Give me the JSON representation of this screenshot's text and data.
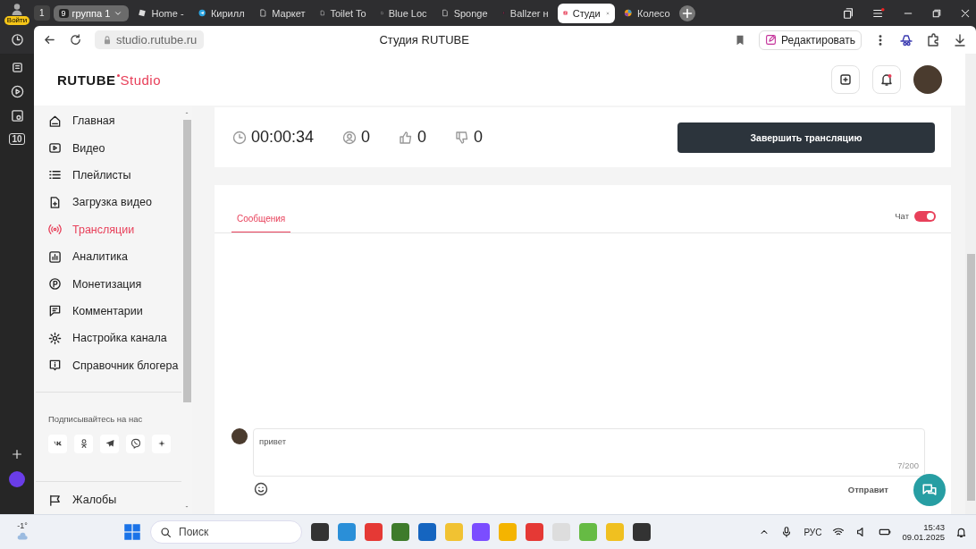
{
  "browser": {
    "account_label": "Войти",
    "tab_counter": "1",
    "group": {
      "count": "9",
      "label": "группа 1"
    },
    "tabs": [
      {
        "label": "Home -",
        "kind": "roblox",
        "selected": false
      },
      {
        "label": "Кирилл",
        "kind": "telegram",
        "selected": false
      },
      {
        "label": "Маркет",
        "kind": "doc",
        "selected": false
      },
      {
        "label": "Toilet To",
        "kind": "doc",
        "selected": false
      },
      {
        "label": "Blue Loc",
        "kind": "doc",
        "selected": false
      },
      {
        "label": "Sponge",
        "kind": "doc",
        "selected": false
      },
      {
        "label": "Ballzer н",
        "kind": "rsquare",
        "selected": false
      },
      {
        "label": "Студи",
        "kind": "studio",
        "selected": true
      },
      {
        "label": "Колесо",
        "kind": "wheel",
        "selected": false
      }
    ],
    "address": "studio.rutube.ru",
    "page_title": "Студия RUTUBE",
    "edit_label": "Редактировать",
    "rail_badge": "10"
  },
  "app": {
    "logo": {
      "brand": "RUTUBE",
      "suffix": "Studio"
    },
    "nav": [
      {
        "label": "Главная",
        "kind": "home",
        "selected": false
      },
      {
        "label": "Видео",
        "kind": "video",
        "selected": false
      },
      {
        "label": "Плейлисты",
        "kind": "list",
        "selected": false
      },
      {
        "label": "Загрузка видео",
        "kind": "upload",
        "selected": false
      },
      {
        "label": "Трансляции",
        "kind": "broadcast",
        "selected": true
      },
      {
        "label": "Аналитика",
        "kind": "chart",
        "selected": false
      },
      {
        "label": "Монетизация",
        "kind": "coin",
        "selected": false
      },
      {
        "label": "Комментарии",
        "kind": "comment",
        "selected": false
      },
      {
        "label": "Настройка канала",
        "kind": "gear",
        "selected": false
      },
      {
        "label": "Справочник блогера",
        "kind": "info",
        "selected": false
      }
    ],
    "follow_label": "Подписывайтесь на нас",
    "socials": [
      {
        "kind": "vk"
      },
      {
        "kind": "ok"
      },
      {
        "kind": "telegram"
      },
      {
        "kind": "viber"
      },
      {
        "kind": "star"
      }
    ],
    "complaints_label": "Жалобы"
  },
  "stream": {
    "timer": "00:00:34",
    "viewers": "0",
    "likes": "0",
    "dislikes": "0",
    "end_button": "Завершить трансляцию"
  },
  "chat": {
    "tabs": [
      {
        "label": "Сообщения",
        "selected": true
      }
    ],
    "toggle": {
      "label": "Чат",
      "on": true
    },
    "input": {
      "value": "привет",
      "counter": "7/200"
    },
    "send_label": "Отправит"
  },
  "taskbar": {
    "weather": "-1°",
    "search_placeholder": "Поиск",
    "language": "РУС",
    "time": "15:43",
    "date": "09.01.2025"
  }
}
